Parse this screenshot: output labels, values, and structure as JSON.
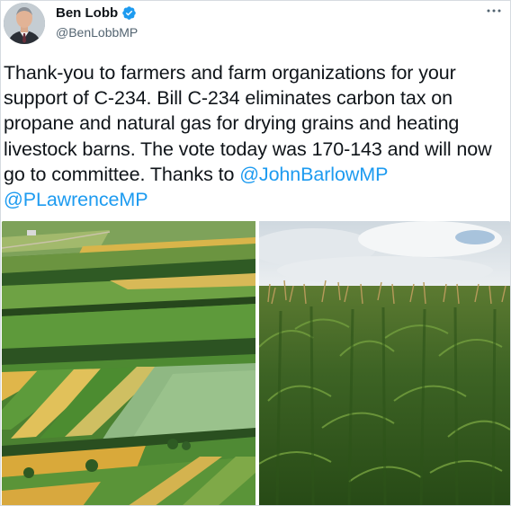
{
  "tweet": {
    "author": {
      "display_name": "Ben Lobb",
      "handle": "@BenLobbMP",
      "verified": true,
      "avatar_icon": "user-avatar-photo"
    },
    "menu_icon": "more-horizontal-icon",
    "text_parts": {
      "line_body": "Thank-you to farmers and farm organizations for your support of C-234.  Bill C-234 eliminates carbon tax on propane and natural gas for drying grains and heating livestock barns.  The vote today was 170-143 and will now go to committee. Thanks to ",
      "mention_1": "@JohnBarlowMP",
      "mention_2": "@PLawrenceMP"
    },
    "media": [
      {
        "icon": "aerial-farmland-photo"
      },
      {
        "icon": "cornfield-photo"
      }
    ]
  },
  "colors": {
    "link": "#1d9bf0",
    "text": "#0f1419",
    "secondary": "#536471",
    "verified": "#1d9bf0"
  }
}
